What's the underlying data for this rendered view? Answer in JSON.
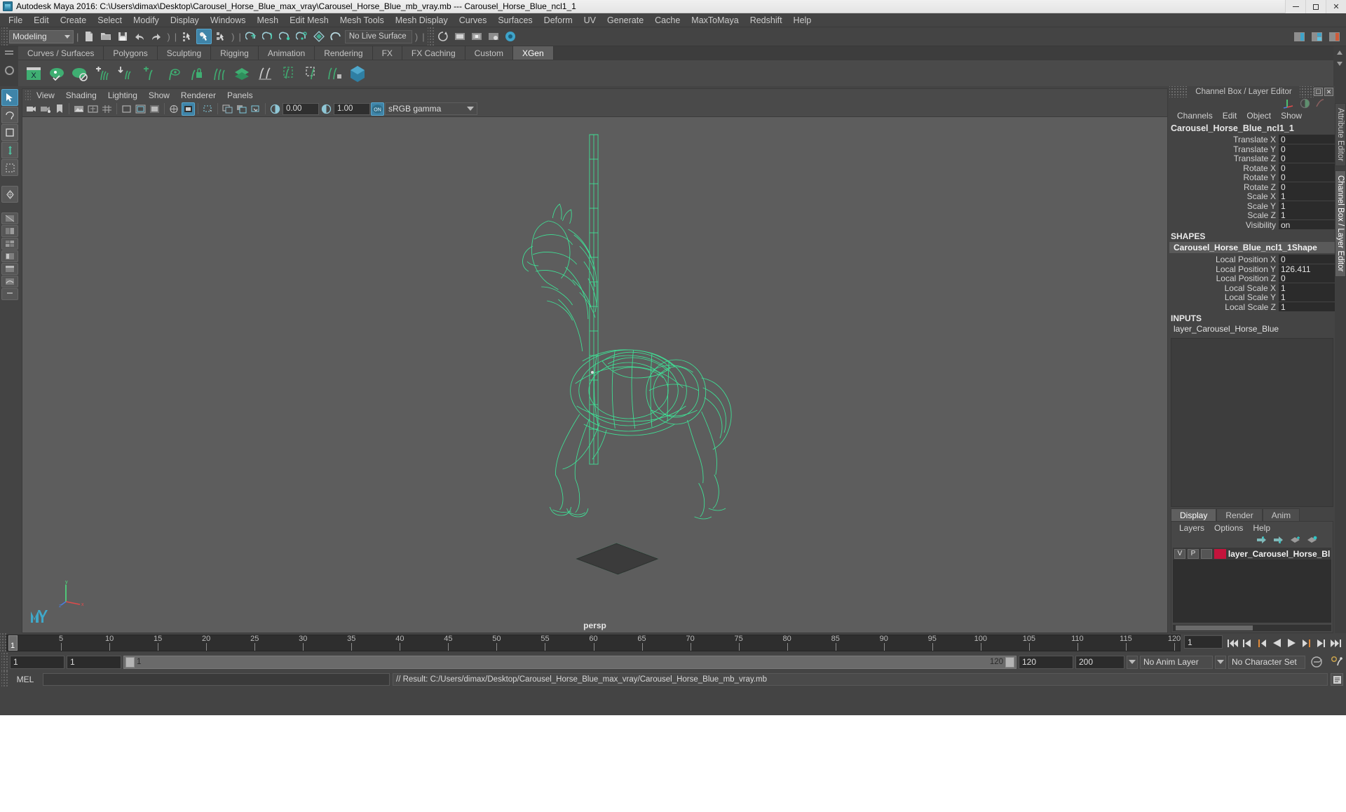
{
  "window": {
    "title": "Autodesk Maya 2016: C:\\Users\\dimax\\Desktop\\Carousel_Horse_Blue_max_vray\\Carousel_Horse_Blue_mb_vray.mb   ---   Carousel_Horse_Blue_ncl1_1",
    "minimize": "–",
    "maximize": "□",
    "close": "✕"
  },
  "menubar": {
    "items": [
      "File",
      "Edit",
      "Create",
      "Select",
      "Modify",
      "Display",
      "Windows",
      "Mesh",
      "Edit Mesh",
      "Mesh Tools",
      "Mesh Display",
      "Curves",
      "Surfaces",
      "Deform",
      "UV",
      "Generate",
      "Cache",
      "MaxToMaya",
      "Redshift",
      "Help"
    ]
  },
  "statusline": {
    "menuset": "Modeling",
    "live_surface": "No Live Surface"
  },
  "shelf": {
    "tabs": [
      "Curves / Surfaces",
      "Polygons",
      "Sculpting",
      "Rigging",
      "Animation",
      "Rendering",
      "FX",
      "FX Caching",
      "Custom",
      "XGen"
    ],
    "active_tab": "XGen"
  },
  "viewport_panel": {
    "menus": [
      "View",
      "Shading",
      "Lighting",
      "Show",
      "Renderer",
      "Panels"
    ],
    "exposure": "0.00",
    "gamma": "1.00",
    "gamma_toggle": "ON",
    "color_space": "sRGB gamma",
    "camera_label": "persp"
  },
  "channel_box": {
    "panel_title": "Channel Box / Layer Editor",
    "menus": [
      "Channels",
      "Edit",
      "Object",
      "Show"
    ],
    "object_name": "Carousel_Horse_Blue_ncl1_1",
    "transform_rows": [
      {
        "label": "Translate X",
        "value": "0"
      },
      {
        "label": "Translate Y",
        "value": "0"
      },
      {
        "label": "Translate Z",
        "value": "0"
      },
      {
        "label": "Rotate X",
        "value": "0"
      },
      {
        "label": "Rotate Y",
        "value": "0"
      },
      {
        "label": "Rotate Z",
        "value": "0"
      },
      {
        "label": "Scale X",
        "value": "1"
      },
      {
        "label": "Scale Y",
        "value": "1"
      },
      {
        "label": "Scale Z",
        "value": "1"
      },
      {
        "label": "Visibility",
        "value": "on"
      }
    ],
    "shapes_title": "SHAPES",
    "shape_name": "Carousel_Horse_Blue_ncl1_1Shape",
    "shape_rows": [
      {
        "label": "Local Position X",
        "value": "0"
      },
      {
        "label": "Local Position Y",
        "value": "126.411"
      },
      {
        "label": "Local Position Z",
        "value": "0"
      },
      {
        "label": "Local Scale X",
        "value": "1"
      },
      {
        "label": "Local Scale Y",
        "value": "1"
      },
      {
        "label": "Local Scale Z",
        "value": "1"
      }
    ],
    "inputs_title": "INPUTS",
    "input_name": "layer_Carousel_Horse_Blue"
  },
  "dock_tabs": {
    "attribute_editor": "Attribute Editor",
    "channel_box": "Channel Box / Layer Editor"
  },
  "layer_editor": {
    "tabs": [
      "Display",
      "Render",
      "Anim"
    ],
    "active_tab": "Display",
    "menus": [
      "Layers",
      "Options",
      "Help"
    ],
    "layers": [
      {
        "visibility": "V",
        "playback": "P",
        "shading": "",
        "color": "#c4143c",
        "name": "layer_Carousel_Horse_Bl"
      }
    ]
  },
  "timeline": {
    "current_frame": "1",
    "ticks": [
      "5",
      "10",
      "15",
      "20",
      "25",
      "30",
      "35",
      "40",
      "45",
      "50",
      "55",
      "60",
      "65",
      "70",
      "75",
      "80",
      "85",
      "90",
      "95",
      "100",
      "105",
      "110",
      "115",
      "120"
    ],
    "range_start": "1",
    "range_end": "120",
    "anim_start": "1",
    "anim_end": "120",
    "playback_start": "1",
    "playback_end": "200",
    "slider_start": "1",
    "slider_end": "120",
    "anim_layer": "No Anim Layer",
    "character_set": "No Character Set"
  },
  "command_line": {
    "label": "MEL",
    "input_value": "",
    "result": "// Result: C:/Users/dimax/Desktop/Carousel_Horse_Blue_max_vray/Carousel_Horse_Blue_mb_vray.mb"
  },
  "colors": {
    "wireframe_green": "#3dea9a",
    "viewport_bg": "#5d5d5d",
    "accent_blue": "#3f84a8",
    "layer_red": "#c4143c"
  }
}
